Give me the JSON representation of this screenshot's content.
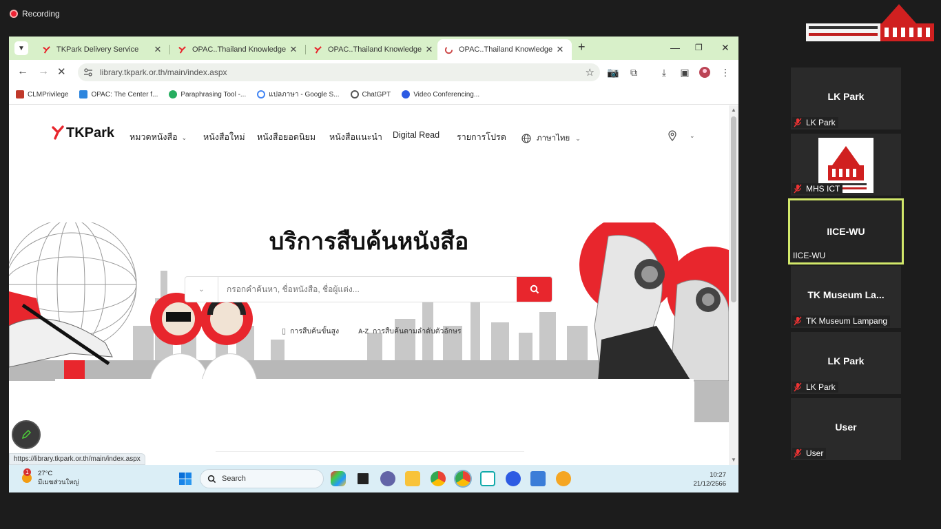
{
  "recording": {
    "label": "Recording"
  },
  "browser": {
    "tabs": [
      {
        "label": "TKPark Delivery Service",
        "active": false
      },
      {
        "label": "OPAC..Thailand Knowledge Park",
        "active": false
      },
      {
        "label": "OPAC..Thailand Knowledge Park",
        "active": false
      },
      {
        "label": "OPAC..Thailand Knowledge Park",
        "active": true
      }
    ],
    "url": "library.tkpark.or.th/main/index.aspx",
    "bookmarks": [
      {
        "label": "CLMPrivilege",
        "color": "#c0392b"
      },
      {
        "label": "OPAC: The Center f...",
        "color": "#2e86de"
      },
      {
        "label": "Paraphrasing Tool -...",
        "color": "#27ae60"
      },
      {
        "label": "แปลภาษา - Google S...",
        "color": "#4285f4"
      },
      {
        "label": "ChatGPT",
        "color": "#555555"
      },
      {
        "label": "Video Conferencing...",
        "color": "#2d5be3"
      }
    ],
    "status_url": "https://library.tkpark.or.th/main/index.aspx"
  },
  "site": {
    "brand": "TKPark",
    "nav": {
      "categories": "หมวดหนังสือ",
      "new_books": "หนังสือใหม่",
      "popular": "หนังสือยอดนิยม",
      "recommended": "หนังสือแนะนำ",
      "digital_read": "Digital Read",
      "favorites": "รายการโปรด",
      "language": "ภาษาไทย"
    },
    "hero_title": "บริการสืบค้นหนังสือ",
    "search": {
      "placeholder": "กรอกคำค้นหา, ชื่อหนังสือ, ชื่อผู้แต่ง..."
    },
    "advanced_search": "การสืบค้นขั้นสูง",
    "az_prefix": "A-Z",
    "az_search": "การสืบค้นตามลำดับตัวอักษร"
  },
  "taskbar": {
    "temperature": "27°C",
    "weather_desc": "มีเมฆส่วนใหญ่",
    "weather_badge": "1",
    "search_label": "Search",
    "time": "10:27",
    "date": "21/12/2566"
  },
  "participants": [
    {
      "name": "LK Park",
      "label": "LK Park",
      "muted": true,
      "active": false,
      "has_image": false
    },
    {
      "name": "",
      "label": "MHS ICT",
      "muted": true,
      "active": false,
      "has_image": true
    },
    {
      "name": "IICE-WU",
      "label": "IICE-WU",
      "muted": false,
      "active": true,
      "has_image": false
    },
    {
      "name": "TK Museum La...",
      "label": "TK Museum Lampang",
      "muted": true,
      "active": false,
      "has_image": false
    },
    {
      "name": "LK Park",
      "label": "LK Park",
      "muted": true,
      "active": false,
      "has_image": false
    },
    {
      "name": "User",
      "label": "User",
      "muted": true,
      "active": false,
      "has_image": false
    }
  ],
  "colors": {
    "accent_red": "#e8262d",
    "tab_bar": "#d8f0c9",
    "active_speaker": "#d2e86a"
  }
}
